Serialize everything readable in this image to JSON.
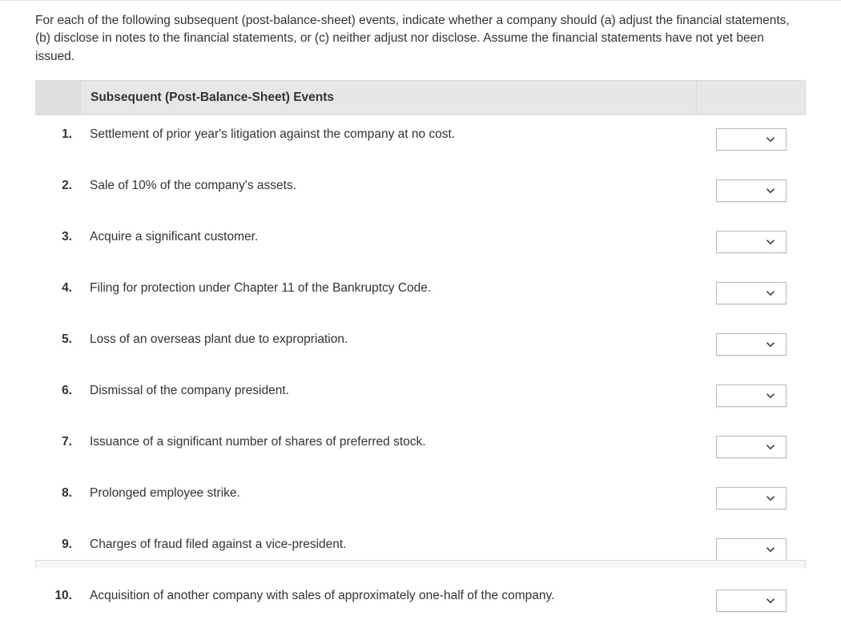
{
  "intro": "For each of the following subsequent (post-balance-sheet) events, indicate whether a company should (a) adjust the financial statements, (b) disclose in notes to the financial statements, or (c) neither adjust nor disclose. Assume the financial statements have not yet been issued.",
  "table": {
    "header": "Subsequent (Post-Balance-Sheet) Events",
    "rows": [
      {
        "num": "1.",
        "text": "Settlement of prior year's litigation against the company at no cost."
      },
      {
        "num": "2.",
        "text": "Sale of 10% of the company's assets."
      },
      {
        "num": "3.",
        "text": "Acquire a significant customer."
      },
      {
        "num": "4.",
        "text": "Filing for protection under Chapter 11 of the Bankruptcy Code."
      },
      {
        "num": "5.",
        "text": "Loss of an overseas plant due to expropriation."
      },
      {
        "num": "6.",
        "text": "Dismissal of the company president."
      },
      {
        "num": "7.",
        "text": "Issuance of a significant number of shares of preferred stock."
      },
      {
        "num": "8.",
        "text": "Prolonged employee strike."
      },
      {
        "num": "9.",
        "text": "Charges of fraud filed against a vice-president."
      },
      {
        "num": "10.",
        "text": "Acquisition of another company with sales of approximately one-half of the company."
      }
    ]
  }
}
